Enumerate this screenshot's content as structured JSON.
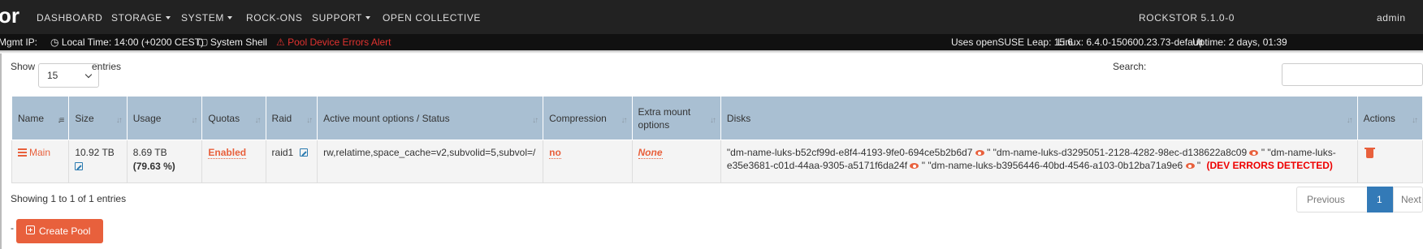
{
  "topnav": {
    "brand_fragment": "or",
    "items": [
      "DASHBOARD",
      "STORAGE",
      "SYSTEM",
      "ROCK-ONS",
      "SUPPORT",
      "OPEN COLLECTIVE"
    ],
    "version": "ROCKSTOR 5.1.0-0",
    "user": "admin"
  },
  "statusbar": {
    "mgmt_ip": "Mgmt IP:",
    "local_time": "Local Time: 14:00 (+0200 CEST)",
    "system_shell": "System Shell",
    "alert": "Pool Device Errors Alert",
    "os_info": "Uses openSUSE Leap: 15.6",
    "linux": "Linux: 6.4.0-150600.23.73-default",
    "uptime": "Uptime: 2 days, 01:39"
  },
  "table_controls": {
    "show_label": "Show",
    "page_size": "15",
    "entries_label": "entries",
    "search_label": "Search:",
    "search_value": ""
  },
  "columns": [
    "Name",
    "Size",
    "Usage",
    "Quotas",
    "Raid",
    "Active mount options / Status",
    "Compression",
    "Extra mount options",
    "Disks",
    "Actions"
  ],
  "rows": [
    {
      "name": "Main",
      "size": "10.92 TB",
      "usage": "8.69 TB",
      "usage_pct": "(79.63 %)",
      "quotas": "Enabled",
      "raid": "raid1",
      "mount_options": "rw,relatime,space_cache=v2,subvolid=5,subvol=/",
      "compression": "no",
      "extra_mount": "None",
      "disks_line1_a": "\"dm-name-luks-b52cf99d-e8f4-4193-9fe0-694ce5b2b6d7",
      "disks_line1_b": "\" \"dm-name-luks-d3295051-2128-4282-98ec-d138622a8c09",
      "disks_line1_c": "\" \"dm-name-luks-",
      "disks_line2_a": "e35e3681-c01d-44aa-9305-a5171f6da24f",
      "disks_line2_b": "\" \"dm-name-luks-b3956446-40bd-4546-a103-0b12ba71a9e6",
      "disks_line2_c": "\"",
      "dev_errors": "(DEV ERRORS DETECTED)"
    }
  ],
  "footer": {
    "info": "Showing 1 to 1 of 1 entries",
    "previous": "Previous",
    "page": "1",
    "next": "Next",
    "dash": "-",
    "create_pool": "Create Pool"
  },
  "colors": {
    "accent": "#e8603c",
    "header_bg": "#a9bfd2",
    "nav_bg": "#222222",
    "active_page": "#337ab7"
  }
}
